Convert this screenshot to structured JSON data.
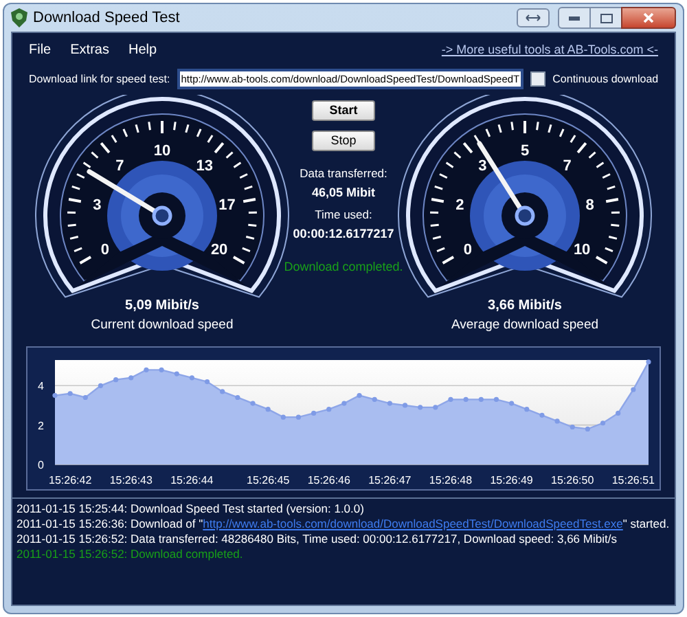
{
  "window": {
    "title": "Download Speed Test"
  },
  "menu": [
    {
      "label": "File"
    },
    {
      "label": "Extras"
    },
    {
      "label": "Help"
    }
  ],
  "promo_link": "-> More useful tools at AB-Tools.com <-",
  "url_row": {
    "label": "Download link for speed test:",
    "value": "http://www.ab-tools.com/download/DownloadSpeedTest/DownloadSpeedT",
    "continuous": {
      "label": "Continuous download",
      "checked": false
    }
  },
  "gauges": [
    {
      "tick_labels": [
        "0",
        "3",
        "7",
        "10",
        "13",
        "17",
        "20"
      ],
      "level": 0.255,
      "reading": "5,09 Mibit/s",
      "caption": "Current download speed"
    },
    {
      "tick_labels": [
        "0",
        "2",
        "3",
        "5",
        "7",
        "8",
        "10"
      ],
      "level": 0.366,
      "reading": "3,66 Mibit/s",
      "caption": "Average download speed"
    }
  ],
  "buttons": [
    {
      "label": "Start"
    },
    {
      "label": "Stop"
    }
  ],
  "stats": [
    {
      "label": "Data transferred:",
      "value": "46,05 Mibit"
    },
    {
      "label": "Time used:",
      "value": "00:00:12.6177217"
    }
  ],
  "status": "Download completed.",
  "chart": {
    "chart_data": {
      "type": "area",
      "ylim": [
        0,
        5.3
      ],
      "yticks": [
        0,
        2,
        4
      ],
      "categories": [
        null,
        "15:26:42",
        null,
        null,
        null,
        "15:26:43",
        null,
        null,
        null,
        "15:26:44",
        null,
        null,
        null,
        null,
        "15:26:45",
        null,
        null,
        null,
        "15:26:46",
        null,
        null,
        null,
        "15:26:47",
        null,
        null,
        null,
        "15:26:48",
        null,
        null,
        null,
        "15:26:49",
        null,
        null,
        null,
        "15:26:50",
        null,
        null,
        null,
        "15:26:51",
        null
      ],
      "series": [
        {
          "color": "#a9bdf0",
          "values": [
            3.5,
            3.6,
            3.4,
            4.0,
            4.3,
            4.4,
            4.8,
            4.8,
            4.6,
            4.4,
            4.2,
            3.7,
            3.4,
            3.1,
            2.8,
            2.4,
            2.4,
            2.6,
            2.8,
            3.1,
            3.5,
            3.3,
            3.1,
            3.0,
            2.9,
            2.9,
            3.3,
            3.3,
            3.3,
            3.3,
            3.1,
            2.8,
            2.5,
            2.2,
            1.9,
            1.8,
            2.1,
            2.6,
            3.8,
            5.2
          ]
        }
      ]
    }
  },
  "log": [
    {
      "kind": "info",
      "text": "2011-01-15 15:25:44: Download Speed Test started (version: 1.0.0)"
    },
    {
      "kind": "link",
      "text": "2011-01-15 15:26:36: Download of \"",
      "link": "http://www.ab-tools.com/download/DownloadSpeedTest/DownloadSpeedTest.exe",
      "after": "\" started."
    },
    {
      "kind": "info",
      "text": "2011-01-15 15:26:52: Data transferred: 48286480 Bits, Time used: 00:00:12.6177217, Download speed: 3,66 Mibit/s"
    },
    {
      "kind": "success",
      "text": "2011-01-15 15:26:52: Download completed."
    }
  ]
}
